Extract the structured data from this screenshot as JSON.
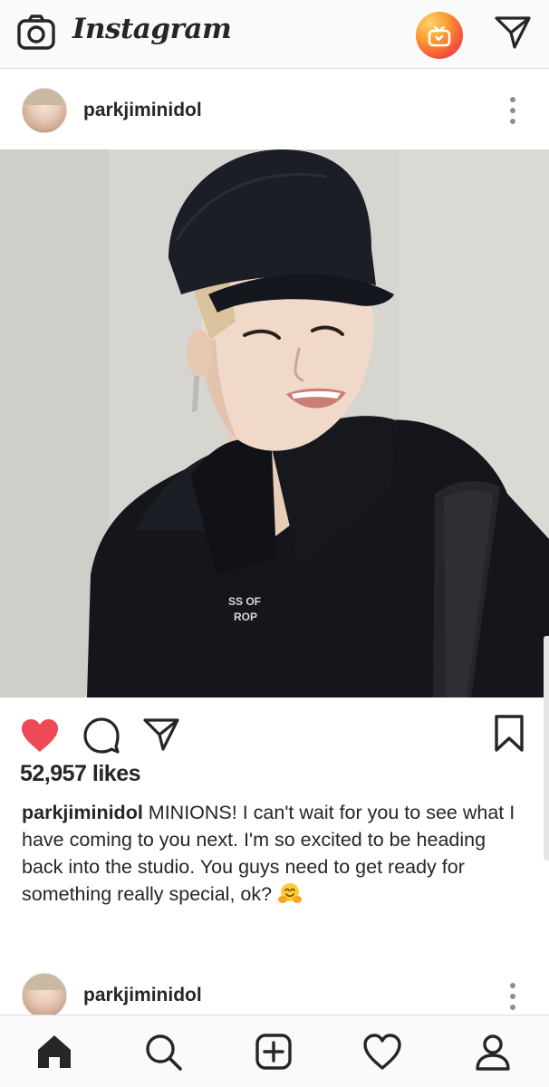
{
  "header": {
    "logo": "Instagram",
    "icons": {
      "camera": "camera-icon",
      "igtv": "igtv-icon",
      "direct": "paper-plane-icon"
    }
  },
  "post": {
    "username": "parkjiminidol",
    "likes": "52,957 likes",
    "caption_user": "parkjiminidol",
    "caption_text": "MINIONS! I can't wait for you to see what I have coming to you next. I'm so excited to be heading back into the studio. You guys need to get ready for something really special, ok?",
    "liked": true,
    "photo_shirt_text": [
      "SS OF",
      "ROP"
    ]
  },
  "next_post": {
    "username": "parkjiminidol"
  },
  "bottom_nav": {
    "items": [
      "home-icon",
      "search-icon",
      "add-post-icon",
      "activity-heart-icon",
      "profile-icon"
    ]
  },
  "colors": {
    "like_red": "#ed4956",
    "text": "#262626",
    "border": "#dbdbdb"
  }
}
